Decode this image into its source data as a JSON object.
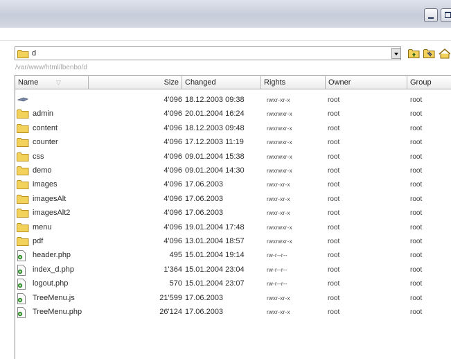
{
  "toolbar": {
    "current_dir": "d",
    "full_path": "/var/www/html/lbenbo/d"
  },
  "columns": {
    "name": "Name",
    "size": "Size",
    "changed": "Changed",
    "rights": "Rights",
    "owner": "Owner",
    "group": "Group"
  },
  "files": [
    {
      "icon": "parent-dir-icon",
      "name": "",
      "size": "4'096",
      "changed": "18.12.2003 09:38",
      "rights": "rwxr-xr-x",
      "owner": "root",
      "group": "root"
    },
    {
      "icon": "folder-icon",
      "name": "admin",
      "size": "4'096",
      "changed": "20.01.2004 16:24",
      "rights": "rwxrwxr-x",
      "owner": "root",
      "group": "root"
    },
    {
      "icon": "folder-icon",
      "name": "content",
      "size": "4'096",
      "changed": "18.12.2003 09:48",
      "rights": "rwxrwxr-x",
      "owner": "root",
      "group": "root"
    },
    {
      "icon": "folder-icon",
      "name": "counter",
      "size": "4'096",
      "changed": "17.12.2003 11:19",
      "rights": "rwxrwxr-x",
      "owner": "root",
      "group": "root"
    },
    {
      "icon": "folder-icon",
      "name": "css",
      "size": "4'096",
      "changed": "09.01.2004 15:38",
      "rights": "rwxrwxr-x",
      "owner": "root",
      "group": "root"
    },
    {
      "icon": "folder-icon",
      "name": "demo",
      "size": "4'096",
      "changed": "09.01.2004 14:30",
      "rights": "rwxrwxr-x",
      "owner": "root",
      "group": "root"
    },
    {
      "icon": "folder-icon",
      "name": "images",
      "size": "4'096",
      "changed": "17.06.2003",
      "rights": "rwxr-xr-x",
      "owner": "root",
      "group": "root"
    },
    {
      "icon": "folder-icon",
      "name": "imagesAlt",
      "size": "4'096",
      "changed": "17.06.2003",
      "rights": "rwxr-xr-x",
      "owner": "root",
      "group": "root"
    },
    {
      "icon": "folder-icon",
      "name": "imagesAlt2",
      "size": "4'096",
      "changed": "17.06.2003",
      "rights": "rwxr-xr-x",
      "owner": "root",
      "group": "root"
    },
    {
      "icon": "folder-icon",
      "name": "menu",
      "size": "4'096",
      "changed": "19.01.2004 17:48",
      "rights": "rwxrwxr-x",
      "owner": "root",
      "group": "root"
    },
    {
      "icon": "folder-icon",
      "name": "pdf",
      "size": "4'096",
      "changed": "13.01.2004 18:57",
      "rights": "rwxrwxr-x",
      "owner": "root",
      "group": "root"
    },
    {
      "icon": "php-file-icon",
      "name": "header.php",
      "size": "495",
      "changed": "15.01.2004 19:14",
      "rights": "rw-r--r--",
      "owner": "root",
      "group": "root"
    },
    {
      "icon": "php-file-icon",
      "name": "index_d.php",
      "size": "1'364",
      "changed": "15.01.2004 23:04",
      "rights": "rw-r--r--",
      "owner": "root",
      "group": "root"
    },
    {
      "icon": "php-file-icon",
      "name": "logout.php",
      "size": "570",
      "changed": "15.01.2004 23:07",
      "rights": "rw-r--r--",
      "owner": "root",
      "group": "root"
    },
    {
      "icon": "php-file-icon",
      "name": "TreeMenu.js",
      "size": "21'599",
      "changed": "17.06.2003",
      "rights": "rwxr-xr-x",
      "owner": "root",
      "group": "root"
    },
    {
      "icon": "php-file-icon",
      "name": "TreeMenu.php",
      "size": "26'124",
      "changed": "17.06.2003",
      "rights": "rwxr-xr-x",
      "owner": "root",
      "group": "root"
    }
  ],
  "colors": {
    "folder": "#f3d25c",
    "folder_edge": "#b8901e",
    "header_border": "#a8a8a8"
  }
}
